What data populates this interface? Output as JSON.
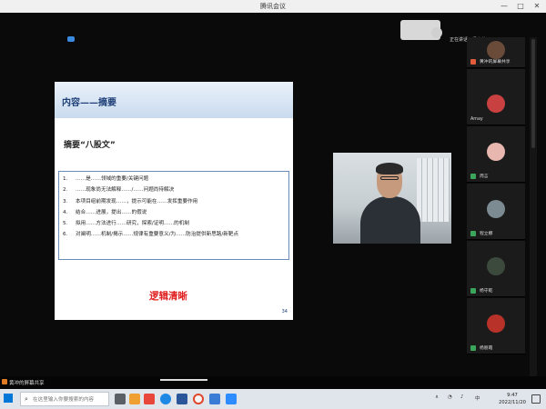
{
  "window": {
    "title": "腾讯会议",
    "minimize_glyph": "—",
    "maximize_glyph": "□",
    "close_glyph": "✕"
  },
  "slide": {
    "title": "内容——摘要",
    "subtitle": "摘要“八股文”",
    "items": [
      {
        "num": "1.",
        "text": "……是……领域的重要/关键问题"
      },
      {
        "num": "2.",
        "text": "……现象尚无法解释……/……问题尚待解决"
      },
      {
        "num": "3.",
        "text": "本项目组前期发现……，提示可能在……发挥重要作用"
      },
      {
        "num": "4.",
        "text": "结合……进展，提出……的假说"
      },
      {
        "num": "5.",
        "text": "拟用……方法进行……研究，探索/证明……的机制"
      },
      {
        "num": "6.",
        "text": "对阐明……机制/揭示……规律有重要意义/为……防治提供新思路/新靶点"
      }
    ],
    "emphasis": "逻辑清晰",
    "page_number": "34"
  },
  "speaking_label": "正在讲话：杨守乾;",
  "participants": [
    {
      "name": "黄冲的屏幕共享",
      "mic": "muted"
    },
    {
      "name": "Amay",
      "mic": "none"
    },
    {
      "name": "周言",
      "mic": "on"
    },
    {
      "name": "程立娜",
      "mic": "on"
    },
    {
      "name": "杨守乾",
      "mic": "on"
    },
    {
      "name": "杨丽霞",
      "mic": "on"
    }
  ],
  "share_bar": {
    "label": "黄冲的屏幕共享"
  },
  "taskbar": {
    "search_placeholder": "在这里输入你要搜索的内容",
    "time": "9:47",
    "date": "2022/11/20",
    "ime": "中",
    "icon_colors": [
      "#e8463a",
      "#f0a030",
      "#1e88e5",
      "#2b579a",
      "#1e88e5",
      "#2d8cff"
    ]
  }
}
